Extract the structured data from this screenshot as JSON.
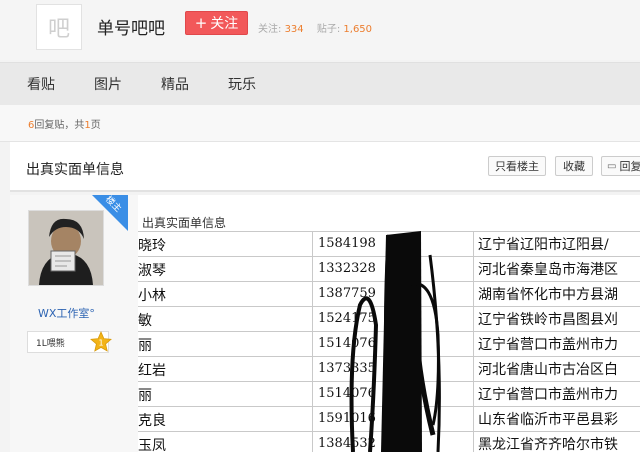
{
  "forum": {
    "avatar_char": "吧",
    "name": "单号吧吧",
    "follow_label": "关注",
    "follow_count_label": "关注:",
    "follow_count": "334",
    "post_count_label": "贴子:",
    "post_count": "1,650"
  },
  "nav": {
    "tabs": [
      "看贴",
      "图片",
      "精品",
      "玩乐"
    ]
  },
  "reply_info": {
    "count": "6",
    "text1": "回复贴，共",
    "pages": "1",
    "text2": "页"
  },
  "thread": {
    "title": "出真实面单信息",
    "buttons": {
      "only_author": "只看楼主",
      "favorite": "收藏",
      "reply": "回复"
    }
  },
  "author": {
    "badge": "楼主",
    "name": "WX工作室°",
    "level_text": "1L喂熊",
    "level_num": "1"
  },
  "post": {
    "text": "出真实面单信息",
    "rows": [
      {
        "name": "晓玲",
        "phone": "1584198",
        "address": "辽宁省辽阳市辽阳县/"
      },
      {
        "name": "淑琴",
        "phone": "1332328",
        "address": "河北省秦皇岛市海港区"
      },
      {
        "name": "小林",
        "phone": "1387759",
        "address": "湖南省怀化市中方县湖"
      },
      {
        "name": "敏",
        "phone": "1524175",
        "address": "辽宁省铁岭市昌图县刈"
      },
      {
        "name": "丽",
        "phone": "1514076",
        "address": "辽宁省营口市盖州市力"
      },
      {
        "name": "红岩",
        "phone": "1373335",
        "address": "河北省唐山市古冶区白"
      },
      {
        "name": "丽",
        "phone": "1514076",
        "address": "辽宁省营口市盖州市力"
      },
      {
        "name": "克良",
        "phone": "1591016",
        "address": "山东省临沂市平邑县彩"
      },
      {
        "name": "玉凤",
        "phone": "1384532",
        "address": "黑龙江省齐齐哈尔市铁"
      }
    ]
  }
}
